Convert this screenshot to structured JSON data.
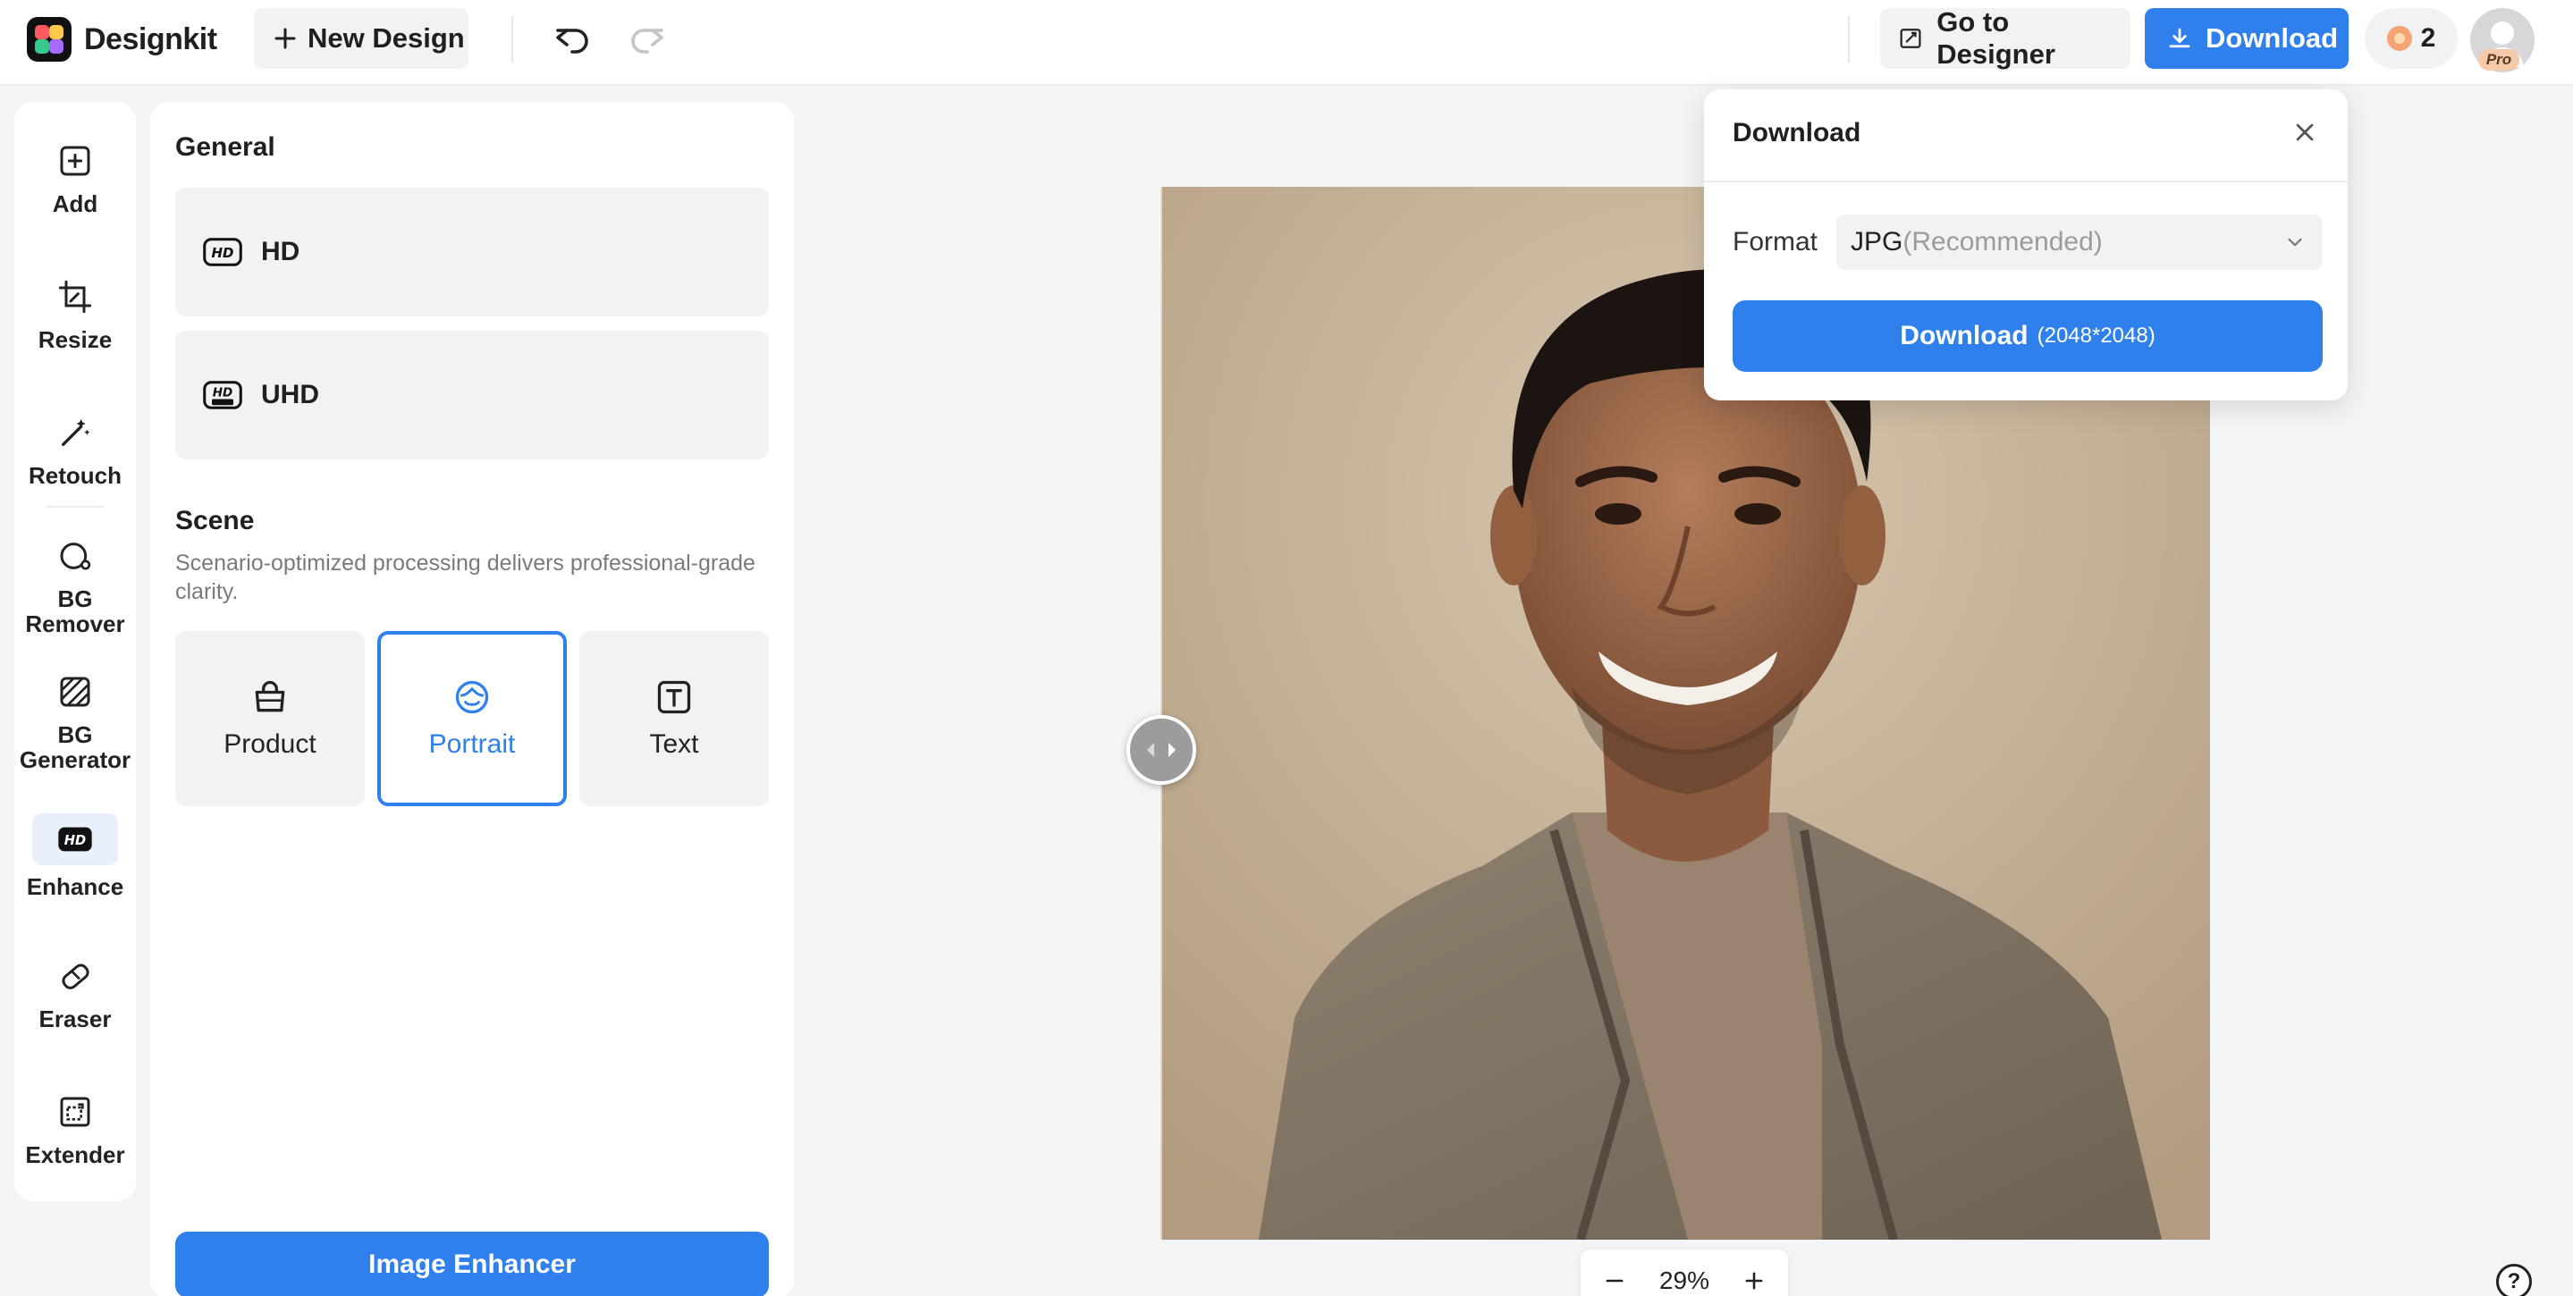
{
  "app": {
    "name": "Designkit"
  },
  "topbar": {
    "new_design": "New Design",
    "go_to_designer": "Go to Designer",
    "download": "Download",
    "credits": "2",
    "badge": "Pro"
  },
  "tools": [
    {
      "label": "Add",
      "icon": "add-icon"
    },
    {
      "label": "Resize",
      "icon": "resize-icon"
    },
    {
      "label": "Retouch",
      "icon": "retouch-icon"
    },
    {
      "label": "BG Remover",
      "icon": "bg-remover-icon"
    },
    {
      "label": "BG Generator",
      "icon": "bg-generator-icon"
    },
    {
      "label": "Enhance",
      "icon": "hd-icon",
      "active": true
    },
    {
      "label": "Eraser",
      "icon": "eraser-icon"
    },
    {
      "label": "Extender",
      "icon": "extender-icon"
    }
  ],
  "panel": {
    "general_title": "General",
    "options": [
      {
        "label": "HD",
        "icon": "hd-icon"
      },
      {
        "label": "UHD",
        "icon": "uhd-icon"
      }
    ],
    "scene_title": "Scene",
    "scene_desc": "Scenario-optimized processing delivers professional-grade clarity.",
    "scenes": [
      {
        "label": "Product",
        "icon": "bag-icon"
      },
      {
        "label": "Portrait",
        "icon": "face-icon",
        "selected": true
      },
      {
        "label": "Text",
        "icon": "text-icon"
      }
    ],
    "action": "Image Enhancer"
  },
  "zoom": {
    "level": "29%"
  },
  "download_popover": {
    "title": "Download",
    "format_label": "Format",
    "format_value": "JPG",
    "format_hint": "(Recommended)",
    "button_label": "Download",
    "button_size": "(2048*2048)"
  },
  "help": {
    "glyph": "?"
  },
  "colors": {
    "accent": "#2f80ed",
    "panel_bg": "#f1f2f4",
    "canvas_bg": "#f3f4f6"
  }
}
